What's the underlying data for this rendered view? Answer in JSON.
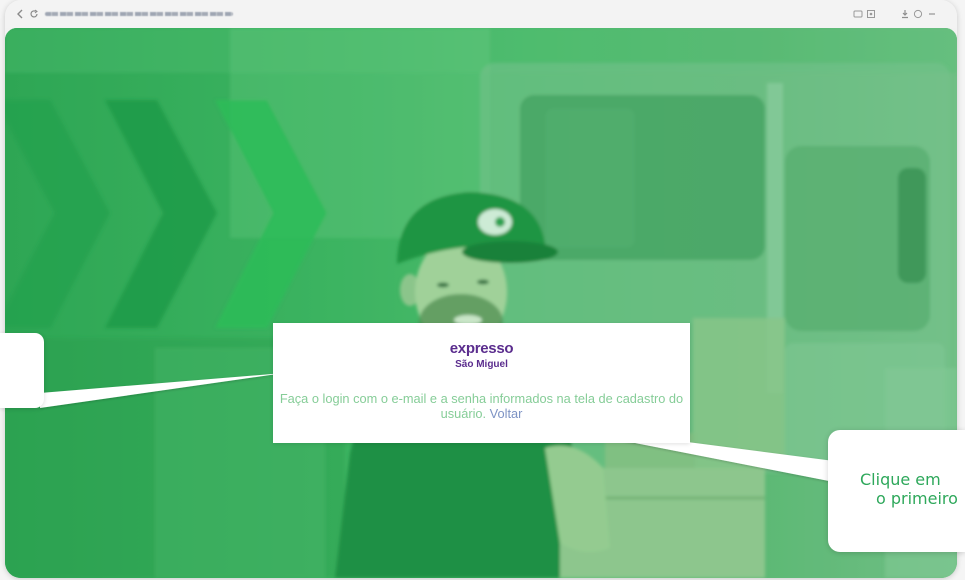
{
  "browser": {
    "nav_icons": [
      "back-arrow-icon",
      "reload-icon"
    ],
    "toolbar_icons": [
      "translate-icon",
      "screenshot-icon",
      "download-icon",
      "profile-icon",
      "menu-icon"
    ]
  },
  "login_card": {
    "logo": {
      "line1": "expresso",
      "line2": "São Miguel"
    },
    "message": "Faça o login com o e-mail e a senha informados na tela de cadastro do usuário.",
    "back_link": "Voltar"
  },
  "tour": {
    "right_tooltip": {
      "line1": "Clique em",
      "line2": "o primeiro"
    }
  },
  "colors": {
    "overlay_green": "#3cb462",
    "brand_purple": "#5b2d8e",
    "tooltip_text": "#2ea85b",
    "message_text": "#86cd98",
    "link_text": "#7d93c4"
  }
}
